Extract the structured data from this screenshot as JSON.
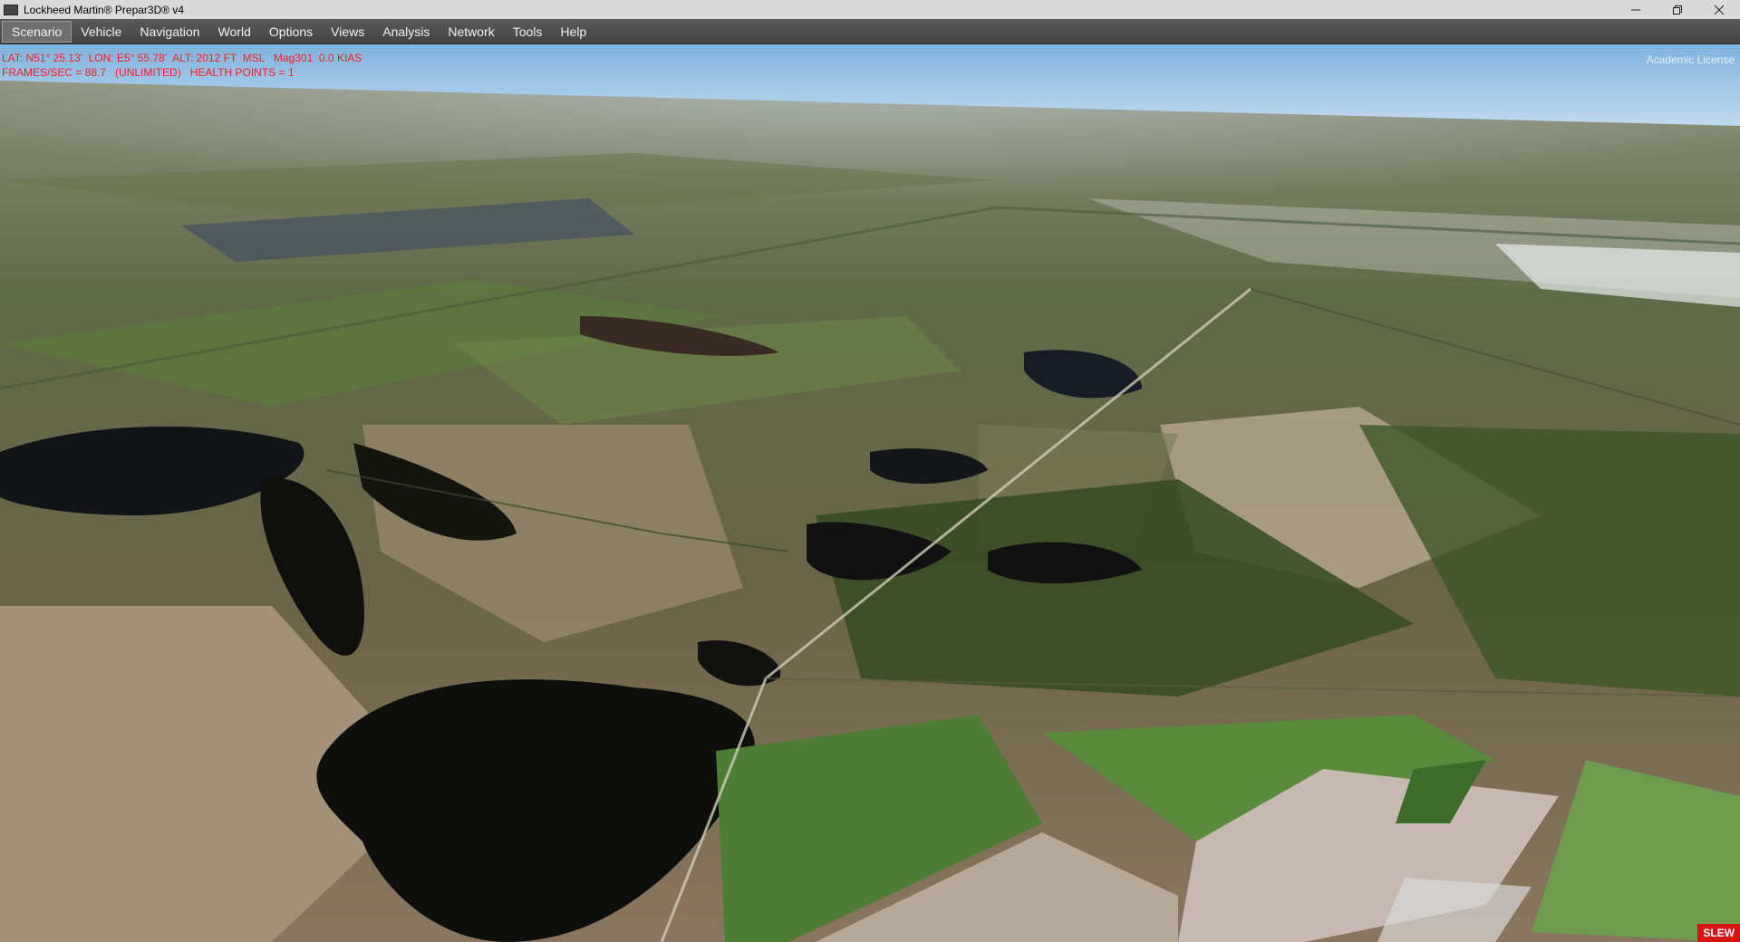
{
  "window": {
    "title": "Lockheed Martin® Prepar3D® v4",
    "controls": {
      "minimize_icon": "minimize-icon",
      "restore_icon": "restore-icon",
      "close_icon": "close-icon"
    }
  },
  "menu": {
    "items": [
      {
        "label": "Scenario",
        "active": true
      },
      {
        "label": "Vehicle"
      },
      {
        "label": "Navigation"
      },
      {
        "label": "World"
      },
      {
        "label": "Options"
      },
      {
        "label": "Views"
      },
      {
        "label": "Analysis"
      },
      {
        "label": "Network"
      },
      {
        "label": "Tools"
      },
      {
        "label": "Help"
      }
    ]
  },
  "hud": {
    "line1": "LAT: N51° 25.13'  LON: E5° 55.78'  ALT: 2012 FT  MSL   Mag301  0.0 KIAS",
    "line2": "FRAMES/SEC = 88.7   (UNLIMITED)   HEALTH POINTS = 1",
    "color": "#ff1b1b"
  },
  "license": "Academic License",
  "slew": "SLEW"
}
